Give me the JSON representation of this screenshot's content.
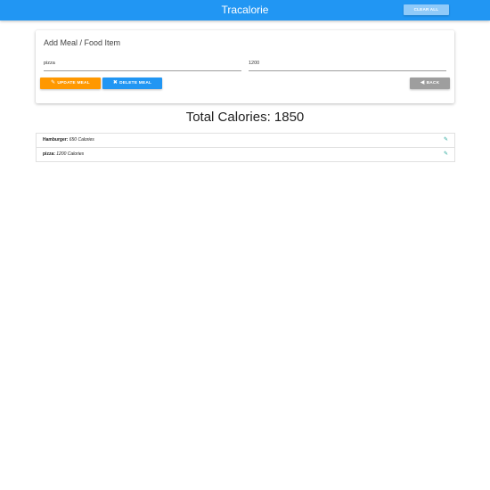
{
  "navbar": {
    "brand": "Tracalorie",
    "clear_all_label": "CLEAR ALL"
  },
  "form": {
    "title": "Add Meal / Food Item",
    "meal_value": "pizza",
    "calories_value": "1200",
    "update_label": "UPDATE MEAL",
    "delete_label": "DELETE MEAL",
    "back_label": "BACK"
  },
  "total": {
    "text": "Total Calories: 1850"
  },
  "items": [
    {
      "name": "Hamburger:",
      "calories": "650 Calories"
    },
    {
      "name": "pizza:",
      "calories": "1200 Calories"
    }
  ],
  "colors": {
    "primary": "#2196f3",
    "update": "#ff9800",
    "back": "#9e9e9e",
    "edit_icon": "#26a69a"
  },
  "icons": {
    "update": "edit-icon",
    "delete": "close-icon",
    "back": "back-circle-icon",
    "edit": "pencil-icon"
  }
}
